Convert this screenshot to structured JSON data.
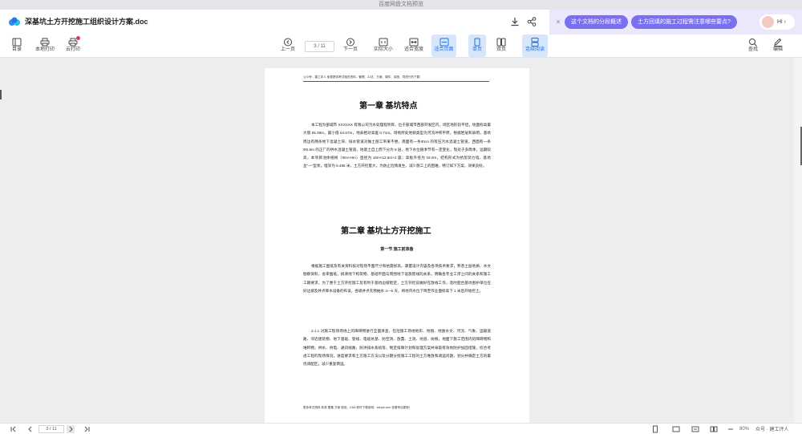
{
  "window": {
    "title": "百度网盘文档预览"
  },
  "header": {
    "doc_title": "深基坑土方开挖施工组织设计方案.doc"
  },
  "ai_panel": {
    "close_label": "×",
    "suggestion_1": "这个文档的分段概述",
    "suggestion_2": "土方回填的施工过程需注意哪些要点?",
    "hi_label": "Hi",
    "hi_arrow": "›"
  },
  "toolbar": {
    "catalog": "目录",
    "local_print": "本地打印",
    "cloud_print": "云打印",
    "prev_page": "上一页",
    "page_indicator": "3 / 11",
    "next_page": "下一页",
    "actual_size": "实际大小",
    "fit_width": "适合宽度",
    "fit_page": "适合页面",
    "single_page": "单页",
    "double_page": "双页",
    "continuous_read": "连续阅读",
    "find": "查找",
    "edit": "编辑"
  },
  "document": {
    "running_header": "公众号：建工评人  免费提供考试相关资料、管理、ZJ法、方案、课件、讲座、同进行的下载!",
    "chapter1_title": "第一章  基坑特点",
    "chapter1_para": "本工程为部城市 XXXXXX 有限公司污水处理程项目，位于部城市西部开发区内，场区地形较平坦，地面标高最大值 65.38m，最小值 64.67m，地表相对高差 0.71m。场地所处地貌类型为河流冲积平原，根据岩层和表明，基坑周边有两条地下混凝土块、排水管道对做土施工带来不便，南面有一条Φ1m 的有压污水混凝土管道，西面有一条Φ0.6m 的正厂的供水混凝土管道，地基土自上而下分为 8 层，地下水位随季节有一定变化，现处于多雨季，远期较高，本项目池体规格（Φm×Hm）直径为 16m×12.5m×2 座；高板外径为 19.0m，结构形式为抗剪剪力墙，基坑呈“一”型状，埋深为 6.485 米，土方开挖量大，为防止险情发生，减少施工上的困难，特订如下方案，效果良好。",
    "chapter2_title": "第二章  基坑土方开挖施工",
    "section1_title": "第一节  施工前准备",
    "chapter2_para1": "根据施工图纸及有关资料核对现场平面尺寸和抗震标高，掌握设计内容及各项技术要求，熟悉土层地质、水文勘察资料，会审图纸，搞清地下构筑物、基础平面与周围地下设施管线的关系，明确各专业工序之间的关系和施工工期要求，为了便于土方开挖施工及有利于基坑边坡稳定，土方开挖前做好在放线工作，及时配合基坑围护单位在好边坡及井点降水设备的布设，各级井点先预抽水 4—5 天，将坑内水位下降至作业面标高下 1 米后开始挖土。",
    "chapter2_para2": "2.1.1 对施工现场场地上的障碍物进行全面清查，包括施工场地地形、地貌、地质水文、河流、气象、运输道路、邻近建筑物、地下基础、管线、电缆坑基、防空洞、放置、土洞、坑道、树根，地面下施工范围内的障碍物和堆积物，供水、供电、通讯线路，防洪排水系统等，制定排障计划和处理方案并采取有效地防护加固措施，综合考虑工程的现场情况，进度要求和土方施工方法以及分期分批施工工程的土方堆放和调运问题，划分并确定土方的最优调配区，减少重复倒运。",
    "running_footer": "更多考试资料  收录  图集  方案  规范、CAD 软件下载官网：wdzyk.com  查看有目更新!"
  },
  "bottombar": {
    "page_indicator": "3 / 11",
    "zoom": "80%"
  },
  "watermark": {
    "text": "众号 · 建工评人"
  }
}
